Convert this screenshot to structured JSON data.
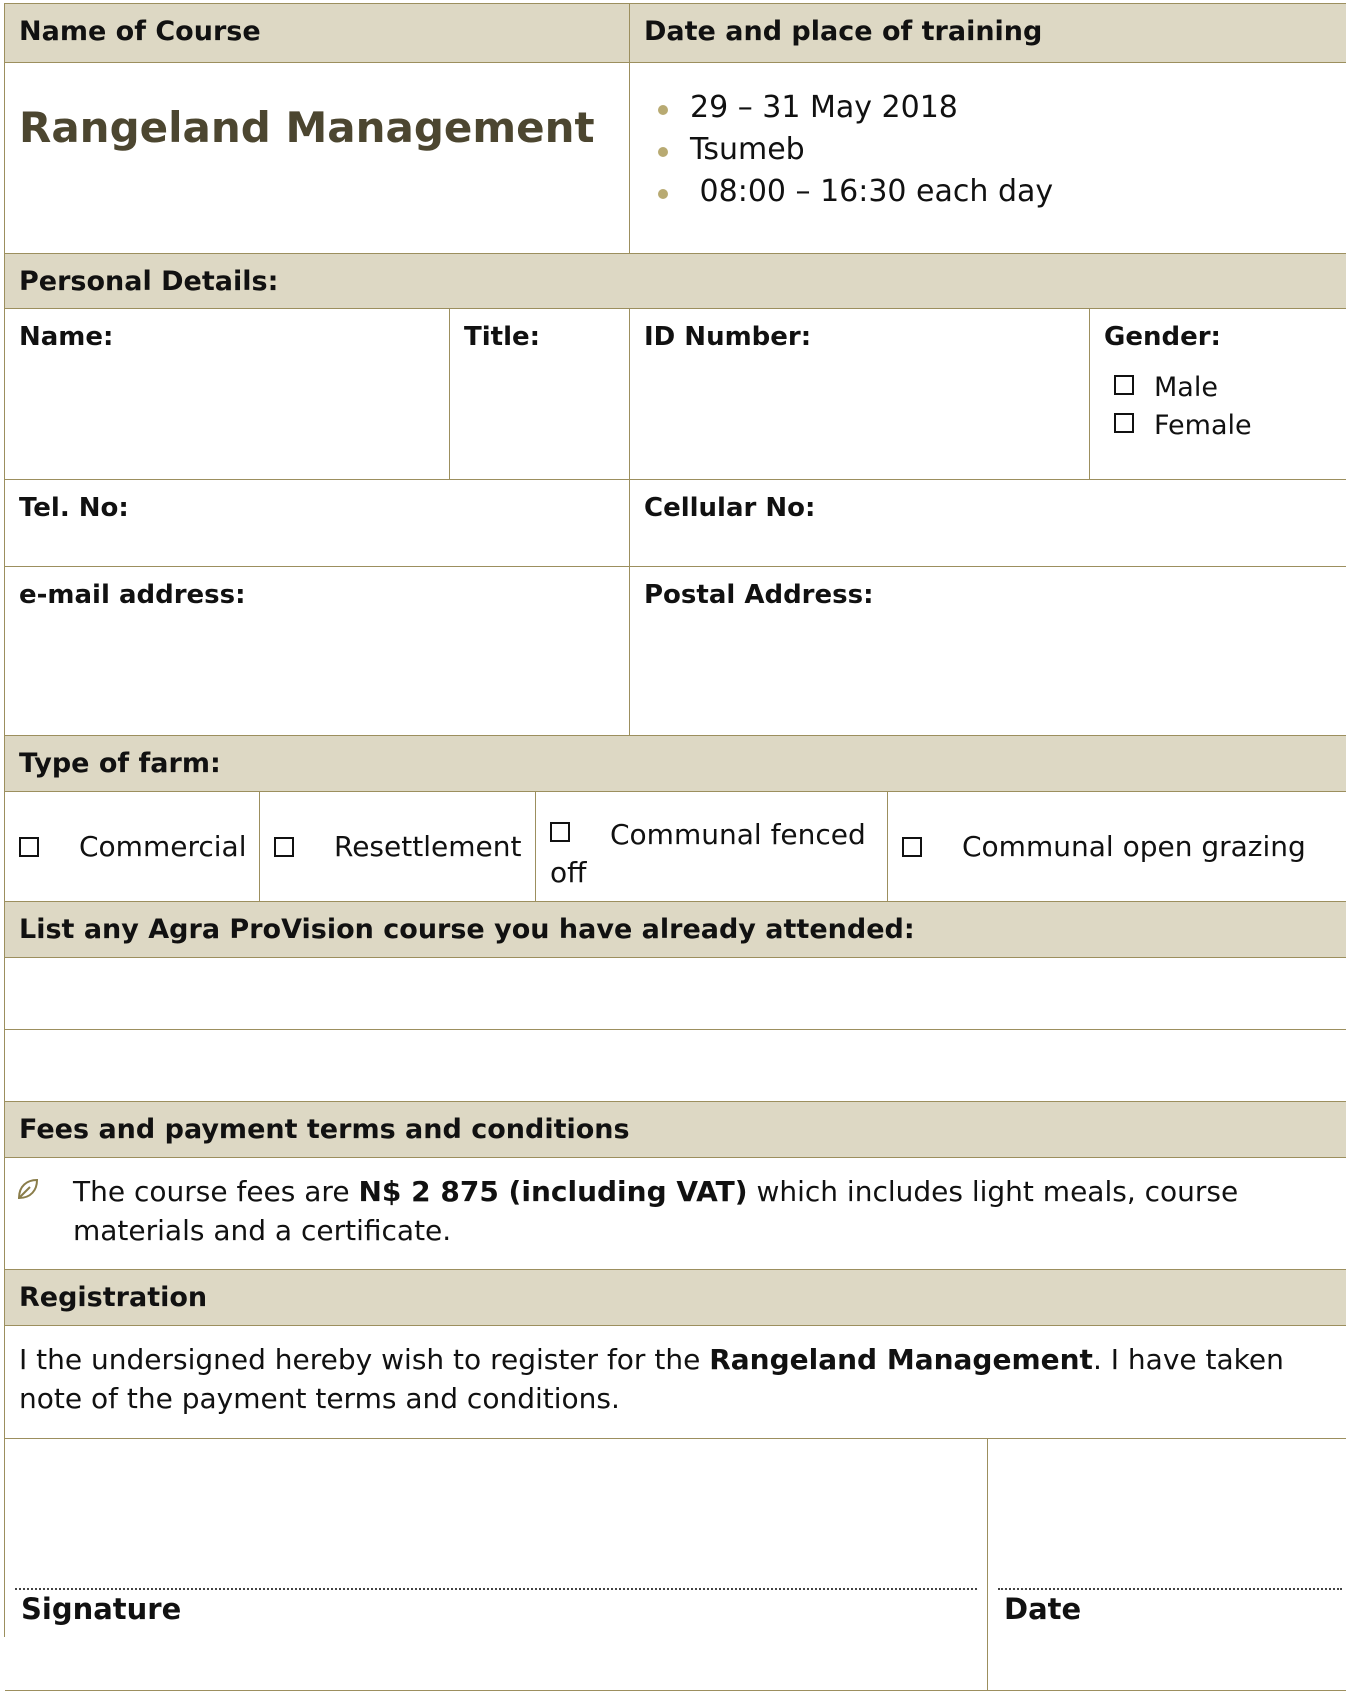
{
  "header": {
    "course_label": "Name of Course",
    "date_place_label": "Date and place of training"
  },
  "course": {
    "title": "Rangeland Management",
    "details": [
      "29 – 31 May 2018",
      "Tsumeb",
      " 08:00 – 16:30 each day"
    ]
  },
  "personal": {
    "heading": "Personal Details:",
    "name_label": "Name:",
    "title_label": "Title:",
    "id_label": "ID Number:",
    "gender_label": "Gender:",
    "gender_options": [
      "Male",
      "Female"
    ],
    "tel_label": "Tel. No:",
    "cell_label": "Cellular No:",
    "email_label": "e-mail address:",
    "postal_label": "Postal Address:"
  },
  "farm": {
    "heading": "Type of farm:",
    "options": [
      "Commercial",
      "Resettlement",
      "Communal fenced off",
      "Communal open grazing"
    ]
  },
  "previous": {
    "heading": "List any Agra ProVision course you have already attended:"
  },
  "fees": {
    "heading": "Fees and payment terms and conditions",
    "text_before": "The course fees are ",
    "text_bold": "N$ 2 875 (including VAT)",
    "text_after": " which includes light meals, course materials and a certificate."
  },
  "registration": {
    "heading": "Registration",
    "text_before": "I the undersigned hereby wish to register for the ",
    "text_bold": "Rangeland Management",
    "text_after": ". I have taken note of the payment terms and conditions.",
    "signature_label": "Signature",
    "date_label": "Date"
  },
  "colors": {
    "header_fill": "#ddd8c4",
    "border": "#9c8f5e",
    "title_text": "#4c4630",
    "bullet": "#b8aa72"
  },
  "icons": {
    "checkbox": "empty-square",
    "fee_bullet": "leaf-icon"
  }
}
